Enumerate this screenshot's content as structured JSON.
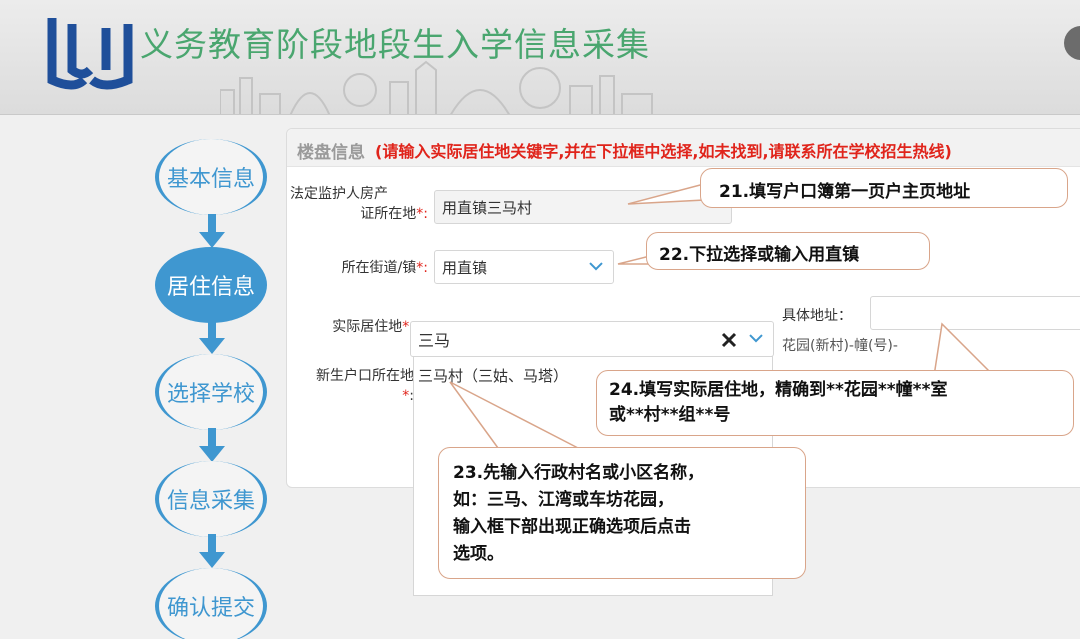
{
  "header": {
    "app_title": "义务教育阶段地段生入学信息采集"
  },
  "steps": [
    {
      "label": "基本信息",
      "active": false
    },
    {
      "label": "居住信息",
      "active": true
    },
    {
      "label": "选择学校",
      "active": false
    },
    {
      "label": "信息采集",
      "active": false
    },
    {
      "label": "确认提交",
      "active": false
    }
  ],
  "panel": {
    "title": "楼盘信息",
    "hint": "(请输入实际居住地关键字,并在下拉框中选择,如未找到,请联系所在学校招生热线)"
  },
  "form": {
    "property_label_line1": "法定监护人房产",
    "property_label_line2": "证所在地",
    "property_value": "用直镇三马村",
    "street_label": "所在街道/镇",
    "street_value": "用直镇",
    "residence_label": "实际居住地",
    "residence_value": "三马",
    "address_label": "具体地址：",
    "address_placeholder": "花园(新村)-幢(号)-",
    "household_label": "新生户口所在地",
    "required_mark": "*:",
    "required_mark_short": "*",
    "colon": ":"
  },
  "dropdown": {
    "options": [
      "三马村（三姑、马塔）"
    ]
  },
  "callouts": {
    "c21": "21.填写户口簿第一页户主页地址",
    "c22": "22.下拉选择或输入用直镇",
    "c24_line1": "24.填写实际居住地，精确到**花园**幢**室",
    "c24_line2": "或**村**组**号",
    "c23_line1": "23.先输入行政村名或小区名称，",
    "c23_line2": "如：三马、江湾或车坊花园，",
    "c23_line3": "输入框下部出现正确选项后点击",
    "c23_line4": "选项。"
  },
  "colors": {
    "accent": "#3f97d0",
    "title_green": "#4aa66f",
    "hint_red": "#e0241b",
    "callout_border": "#d9a58a"
  },
  "icons": {
    "logo": "logo-icon",
    "clear": "close-icon",
    "dropdown": "chevron-down-icon",
    "step_arrow": "arrow-down-icon"
  }
}
